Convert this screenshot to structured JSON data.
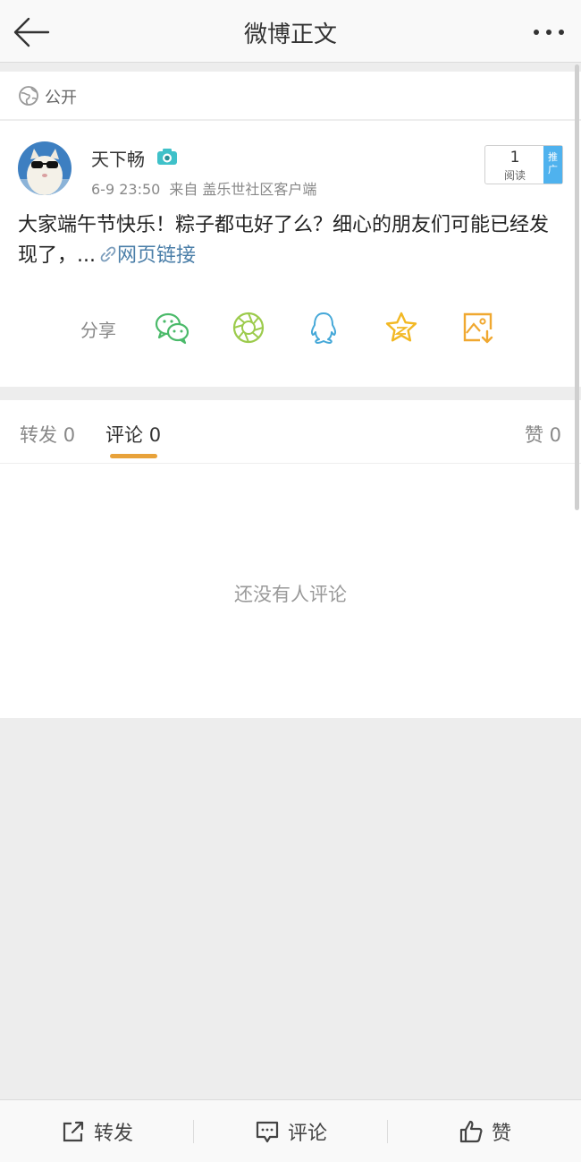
{
  "header": {
    "title": "微博正文",
    "back_icon": "arrow-left-icon",
    "more_icon": "more-dots-icon"
  },
  "visibility": {
    "label": "公开",
    "icon": "globe-icon"
  },
  "post": {
    "author": "天下畅",
    "badge_icon": "camera-badge-icon",
    "time": "6-9 23:50",
    "source": "来自 盖乐世社区客户端",
    "read_count": "1",
    "read_label": "阅读",
    "promote_label": "推广",
    "text": "大家端午节快乐！粽子都屯好了么？细心的朋友们可能已经发现了，...",
    "link_text": "网页链接"
  },
  "share": {
    "label": "分享",
    "items": [
      "wechat-icon",
      "moments-icon",
      "qq-icon",
      "favorite-star-icon",
      "save-image-icon"
    ]
  },
  "tabs": [
    {
      "label": "转发",
      "count": "0"
    },
    {
      "label": "评论",
      "count": "0"
    },
    {
      "label": "赞",
      "count": "0"
    }
  ],
  "comments": {
    "empty_text": "还没有人评论"
  },
  "bottom_bar": {
    "repost": "转发",
    "comment": "评论",
    "like": "赞"
  },
  "colors": {
    "accent": "#e8a23a",
    "link": "#4a7ea8",
    "promote": "#4fb2ee"
  }
}
